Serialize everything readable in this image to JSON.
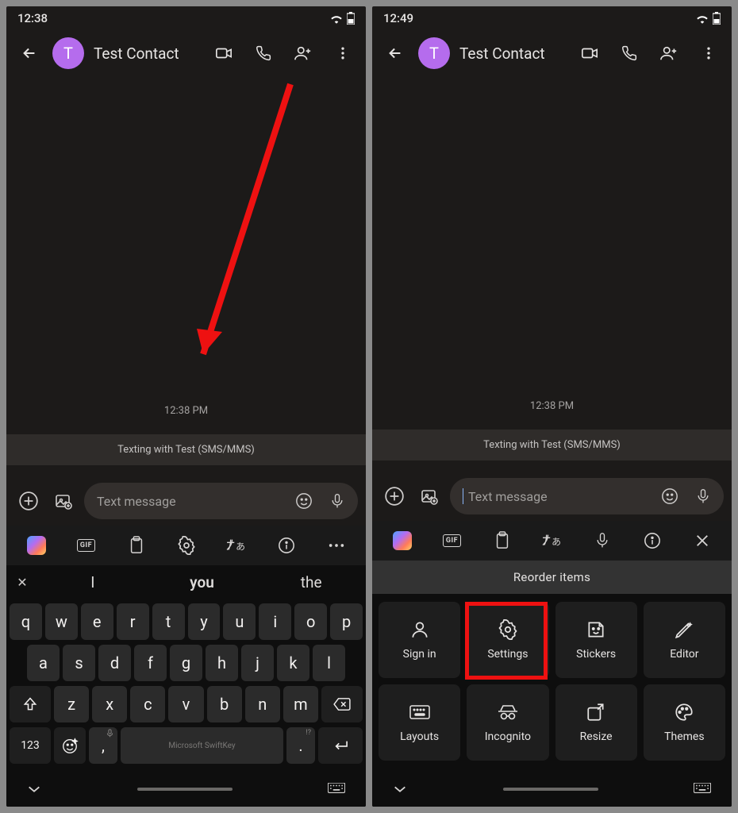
{
  "left": {
    "status_time": "12:38",
    "contact_initial": "T",
    "contact_name": "Test Contact",
    "timestamp": "12:38 PM",
    "info_banner": "Texting with Test (SMS/MMS)",
    "compose_placeholder": "Text message",
    "suggestions": {
      "s1": "I",
      "s2": "you",
      "s3": "the"
    },
    "keys_r1": [
      "q",
      "w",
      "e",
      "r",
      "t",
      "y",
      "u",
      "i",
      "o",
      "p"
    ],
    "keys_r2": [
      "a",
      "s",
      "d",
      "f",
      "g",
      "h",
      "j",
      "k",
      "l"
    ],
    "keys_r3": [
      "z",
      "x",
      "c",
      "v",
      "b",
      "n",
      "m"
    ],
    "key_123": "123",
    "space_label": "Microsoft SwiftKey",
    "key_comma": ",",
    "key_period": ".",
    "period_sup": "!?"
  },
  "right": {
    "status_time": "12:49",
    "contact_initial": "T",
    "contact_name": "Test Contact",
    "timestamp": "12:38 PM",
    "info_banner": "Texting with Test (SMS/MMS)",
    "compose_placeholder": "Text message",
    "reorder_label": "Reorder items",
    "tiles": {
      "signin": "Sign in",
      "settings": "Settings",
      "stickers": "Stickers",
      "editor": "Editor",
      "layouts": "Layouts",
      "incognito": "Incognito",
      "resize": "Resize",
      "themes": "Themes"
    }
  }
}
